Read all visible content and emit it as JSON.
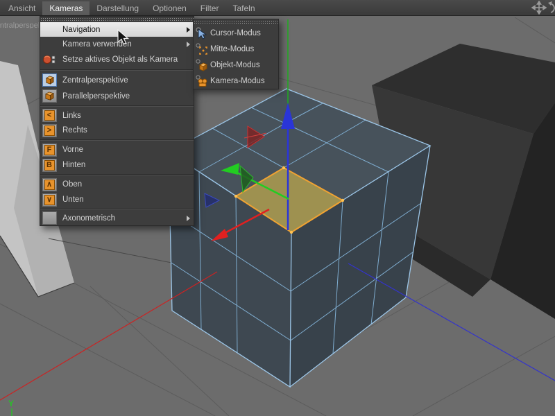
{
  "menubar": {
    "items": [
      {
        "label": "Ansicht"
      },
      {
        "label": "Kameras",
        "active": true
      },
      {
        "label": "Darstellung"
      },
      {
        "label": "Optionen"
      },
      {
        "label": "Filter"
      },
      {
        "label": "Tafeln"
      }
    ]
  },
  "viewport": {
    "camera_label": "Zentralperspektive",
    "axis_label_y": "Y"
  },
  "menu": {
    "items": [
      {
        "label": "Navigation",
        "submenu": true,
        "highlighted": true
      },
      {
        "label": "Kamera verwenden",
        "submenu": true
      },
      {
        "label": "Setze aktives Objekt als Kamera",
        "icon": "set-active-object-as-camera-icon"
      },
      {
        "label": "Zentralperspektive",
        "icon": "central-perspective-icon",
        "active": true
      },
      {
        "label": "Parallelperspektive",
        "icon": "parallel-perspective-icon"
      },
      {
        "label": "Links",
        "glyph": "<"
      },
      {
        "label": "Rechts",
        "glyph": ">"
      },
      {
        "label": "Vorne",
        "glyph": "F"
      },
      {
        "label": "Hinten",
        "glyph": "B"
      },
      {
        "label": "Oben",
        "glyph": "∧"
      },
      {
        "label": "Unten",
        "glyph": "∨"
      },
      {
        "label": "Axonometrisch",
        "submenu": true
      }
    ]
  },
  "submenu": {
    "items": [
      {
        "label": "Cursor-Modus",
        "icon": "cursor-mode-icon"
      },
      {
        "label": "Mitte-Modus",
        "icon": "center-mode-icon"
      },
      {
        "label": "Objekt-Modus",
        "icon": "object-mode-icon"
      },
      {
        "label": "Kamera-Modus",
        "icon": "camera-mode-icon"
      }
    ]
  },
  "colors": {
    "viewport_background": "#6c6c6c",
    "selection_orange": "#f0a232",
    "selected_face_fill": "#9e9150",
    "axis_x_red": "#dd2222",
    "axis_y_green": "#22bb22",
    "axis_z_blue": "#2a35d8",
    "wireframe_blue": "#8ab8dc",
    "icon_orange": "#e8932c"
  }
}
